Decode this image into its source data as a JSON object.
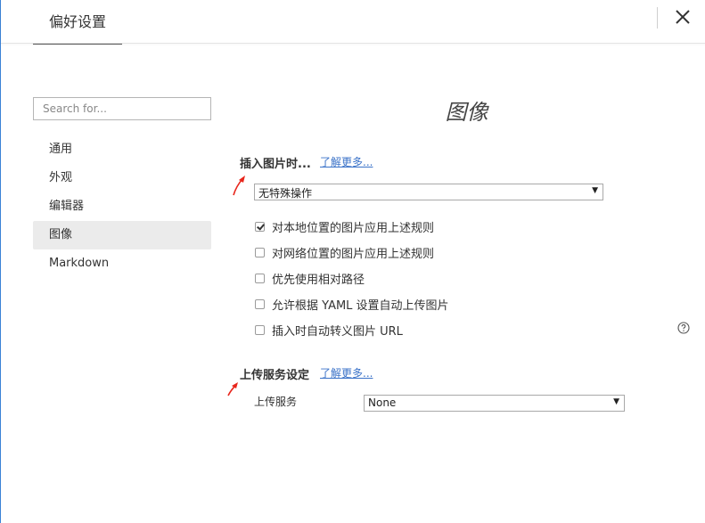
{
  "window": {
    "title": "偏好设置"
  },
  "sidebar": {
    "search_placeholder": "Search for...",
    "items": [
      {
        "label": "通用"
      },
      {
        "label": "外观"
      },
      {
        "label": "编辑器"
      },
      {
        "label": "图像",
        "active": true
      },
      {
        "label": "Markdown"
      }
    ]
  },
  "main": {
    "page_title": "图像",
    "insert_section": {
      "title": "插入图片时...",
      "learn_more": "了解更多...",
      "action_select": "无特殊操作",
      "options": [
        {
          "label": "对本地位置的图片应用上述规则",
          "checked": true
        },
        {
          "label": "对网络位置的图片应用上述规则",
          "checked": false
        },
        {
          "label": "优先使用相对路径",
          "checked": false
        },
        {
          "label": "允许根据 YAML 设置自动上传图片",
          "checked": false
        },
        {
          "label": "插入时自动转义图片 URL",
          "checked": false
        }
      ]
    },
    "upload_section": {
      "title": "上传服务设定",
      "learn_more": "了解更多...",
      "service_label": "上传服务",
      "service_select": "None"
    }
  },
  "colors": {
    "accent": "#3a72c8",
    "annotation_arrow": "#e8261c",
    "active_bg": "#ebebeb"
  },
  "icons": {
    "close": "close-icon",
    "help": "help-circle-icon",
    "dropdown": "triangle-down-icon"
  }
}
